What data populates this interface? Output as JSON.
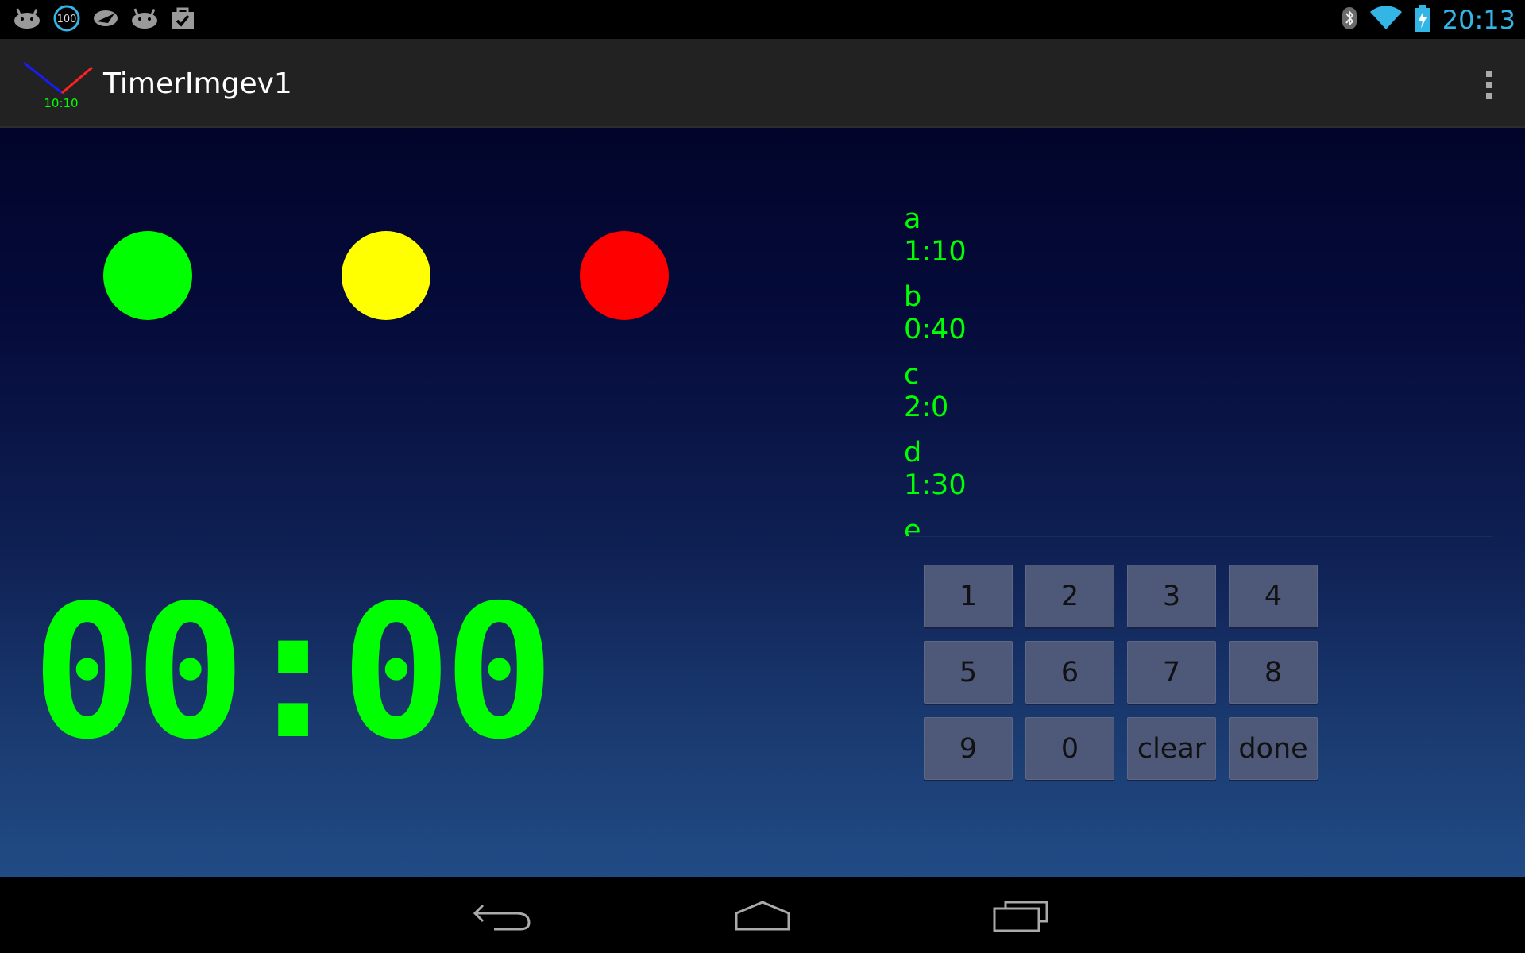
{
  "status_bar": {
    "notification_icons": [
      "android-icon",
      "battery-100-icon",
      "messenger-icon",
      "android-icon",
      "shopping-bag-check-icon"
    ],
    "battery_badge": "100",
    "time": "20:13",
    "colors": {
      "clock": "#33b5e5"
    }
  },
  "action_bar": {
    "title": "TimerImgev1",
    "logo_time": "10:10",
    "overflow_icon": "overflow-menu-icon"
  },
  "traffic_lights": [
    {
      "name": "green-light",
      "color": "#00ff00"
    },
    {
      "name": "yellow-light",
      "color": "#ffff00"
    },
    {
      "name": "red-light",
      "color": "#ff0000"
    }
  ],
  "timer": {
    "display": "00:00",
    "color": "#00ff00"
  },
  "intervals": [
    {
      "label": "a",
      "time": "1:10"
    },
    {
      "label": "b",
      "time": "0:40"
    },
    {
      "label": "c",
      "time": "2:0"
    },
    {
      "label": "d",
      "time": "1:30"
    },
    {
      "label": "e",
      "time": ""
    }
  ],
  "keypad": {
    "keys": [
      "1",
      "2",
      "3",
      "4",
      "5",
      "6",
      "7",
      "8",
      "9",
      "0",
      "clear",
      "done"
    ]
  },
  "nav_bar": {
    "icons": [
      "back-icon",
      "home-icon",
      "recent-apps-icon"
    ]
  }
}
